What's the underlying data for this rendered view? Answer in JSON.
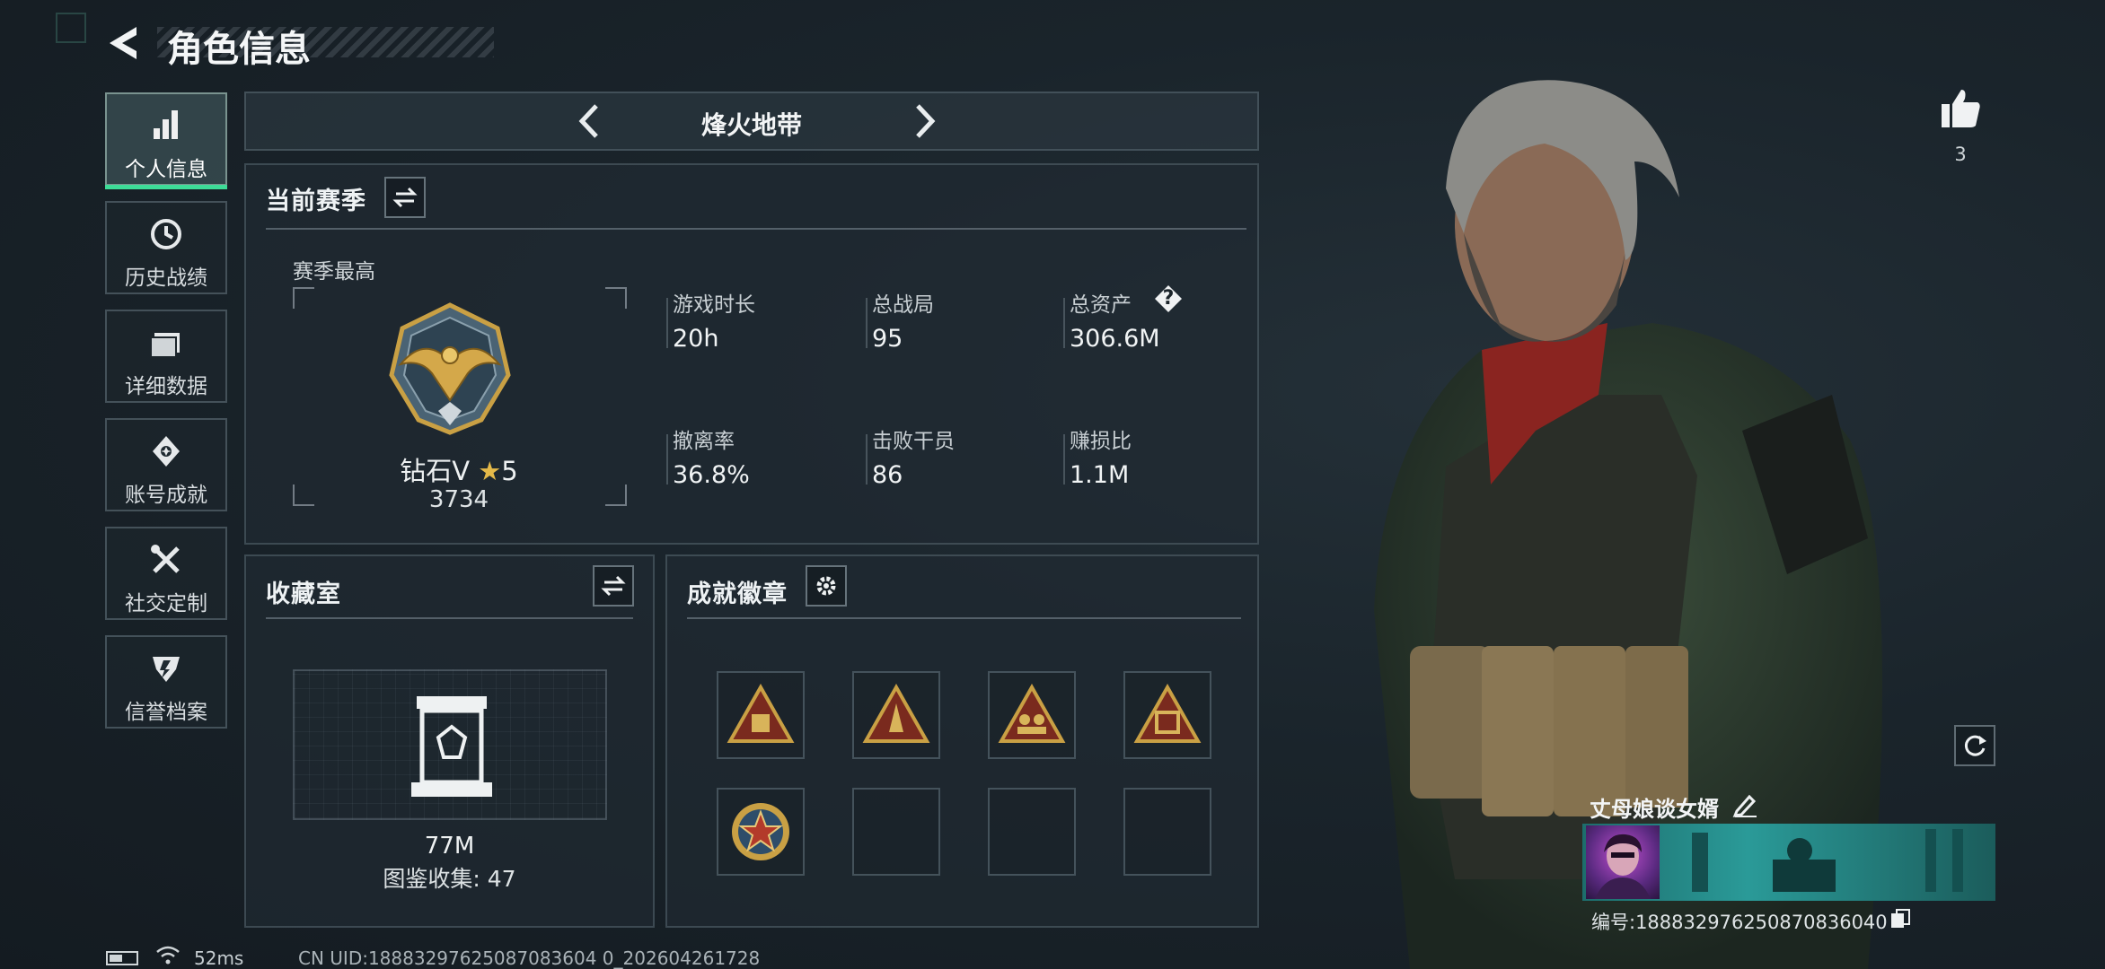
{
  "header": {
    "title": "角色信息"
  },
  "sidebar": {
    "items": [
      {
        "label": "个人信息",
        "icon": "bar-chart-icon",
        "active": true
      },
      {
        "label": "历史战绩",
        "icon": "clock-history-icon"
      },
      {
        "label": "详细数据",
        "icon": "folder-data-icon"
      },
      {
        "label": "账号成就",
        "icon": "medal-achievement-icon"
      },
      {
        "label": "社交定制",
        "icon": "tools-icon"
      },
      {
        "label": "信誉档案",
        "icon": "shield-reputation-icon"
      }
    ]
  },
  "mode_selector": {
    "label": "烽火地带"
  },
  "season": {
    "title": "当前赛季",
    "peak_label": "赛季最高",
    "rank_name": "钻石V",
    "rank_stars": "5",
    "rank_points": "3734",
    "stats": [
      {
        "label": "游戏时长",
        "value": "20h"
      },
      {
        "label": "总战局",
        "value": "95"
      },
      {
        "label": "总资产",
        "value": "306.6M"
      },
      {
        "label": "撤离率",
        "value": "36.8%"
      },
      {
        "label": "击败干员",
        "value": "86"
      },
      {
        "label": "赚损比",
        "value": "1.1M"
      }
    ],
    "help_symbol": "?"
  },
  "collection": {
    "title": "收藏室",
    "value": "77M",
    "catalog_text": "图鉴收集: 47"
  },
  "achievements": {
    "title": "成就徽章",
    "badges": [
      {
        "icon": "triangle-badge-crate-icon",
        "filled": true
      },
      {
        "icon": "triangle-badge-rocket-icon",
        "filled": true
      },
      {
        "icon": "triangle-badge-squad-icon",
        "filled": true
      },
      {
        "icon": "triangle-badge-box-icon",
        "filled": true
      },
      {
        "icon": "round-star-badge-icon",
        "filled": true
      },
      {
        "filled": false
      },
      {
        "filled": false
      },
      {
        "filled": false
      }
    ]
  },
  "likes": {
    "count": "3",
    "icon": "thumbs-up-icon"
  },
  "profile": {
    "nickname": "丈母娘谈女婿",
    "id_text": "编号:18883297625087083604",
    "id_suffix": "0"
  },
  "status_bar": {
    "ping": "52ms",
    "uid_text": "CN UID:18883297625087083604 0_202604261728"
  },
  "colors": {
    "accent_green": "#3ddc97",
    "background": "#1a242b",
    "gold": "#c9a044"
  }
}
